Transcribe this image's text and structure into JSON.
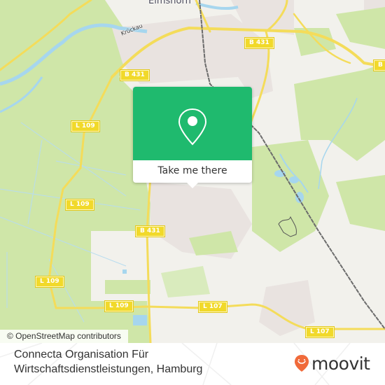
{
  "map": {
    "place_labels": [
      {
        "text": "Elmshorn",
        "kind": "town"
      }
    ],
    "water_labels": [
      {
        "text": "Krückau"
      }
    ],
    "road_labels": [
      {
        "text": "B 431"
      },
      {
        "text": "B 431"
      },
      {
        "text": "B"
      },
      {
        "text": "L 109"
      },
      {
        "text": "L 109"
      },
      {
        "text": "B 431"
      },
      {
        "text": "L 109"
      },
      {
        "text": "L 109"
      },
      {
        "text": "L 107"
      },
      {
        "text": "L 107"
      }
    ],
    "attribution": "© OpenStreetMap contributors",
    "colors": {
      "land": "#f2f1ec",
      "green": "#cfe6a8",
      "urban": "#e9e3e0",
      "water": "#a6d6ee",
      "road": "#f4dc5a",
      "rail": "#6b6b6b"
    }
  },
  "popup": {
    "icon": "location-pin-icon",
    "button_label": "Take me there",
    "accent_color": "#1fba6e"
  },
  "footer": {
    "title": "Connecta Organisation Für Wirtschaftsdienstleistungen, Hamburg",
    "brand": {
      "name": "moovit",
      "icon": "moovit-pin-icon",
      "color": "#f06a3a"
    }
  }
}
